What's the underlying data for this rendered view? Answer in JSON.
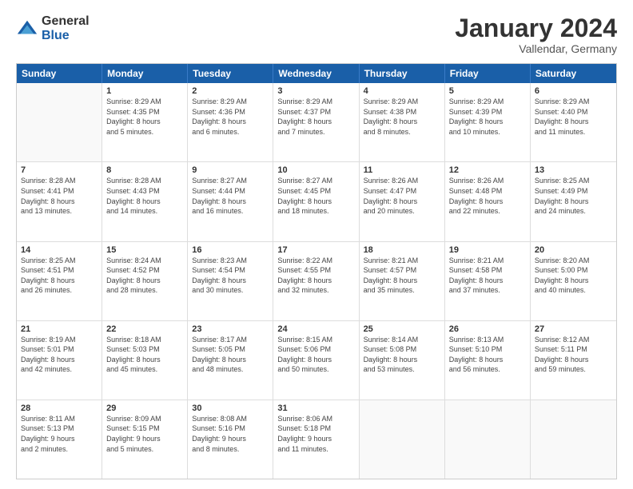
{
  "header": {
    "logo_general": "General",
    "logo_blue": "Blue",
    "month_title": "January 2024",
    "location": "Vallendar, Germany"
  },
  "days_of_week": [
    "Sunday",
    "Monday",
    "Tuesday",
    "Wednesday",
    "Thursday",
    "Friday",
    "Saturday"
  ],
  "weeks": [
    [
      {
        "day": "",
        "info": ""
      },
      {
        "day": "1",
        "info": "Sunrise: 8:29 AM\nSunset: 4:35 PM\nDaylight: 8 hours\nand 5 minutes."
      },
      {
        "day": "2",
        "info": "Sunrise: 8:29 AM\nSunset: 4:36 PM\nDaylight: 8 hours\nand 6 minutes."
      },
      {
        "day": "3",
        "info": "Sunrise: 8:29 AM\nSunset: 4:37 PM\nDaylight: 8 hours\nand 7 minutes."
      },
      {
        "day": "4",
        "info": "Sunrise: 8:29 AM\nSunset: 4:38 PM\nDaylight: 8 hours\nand 8 minutes."
      },
      {
        "day": "5",
        "info": "Sunrise: 8:29 AM\nSunset: 4:39 PM\nDaylight: 8 hours\nand 10 minutes."
      },
      {
        "day": "6",
        "info": "Sunrise: 8:29 AM\nSunset: 4:40 PM\nDaylight: 8 hours\nand 11 minutes."
      }
    ],
    [
      {
        "day": "7",
        "info": "Sunrise: 8:28 AM\nSunset: 4:41 PM\nDaylight: 8 hours\nand 13 minutes."
      },
      {
        "day": "8",
        "info": "Sunrise: 8:28 AM\nSunset: 4:43 PM\nDaylight: 8 hours\nand 14 minutes."
      },
      {
        "day": "9",
        "info": "Sunrise: 8:27 AM\nSunset: 4:44 PM\nDaylight: 8 hours\nand 16 minutes."
      },
      {
        "day": "10",
        "info": "Sunrise: 8:27 AM\nSunset: 4:45 PM\nDaylight: 8 hours\nand 18 minutes."
      },
      {
        "day": "11",
        "info": "Sunrise: 8:26 AM\nSunset: 4:47 PM\nDaylight: 8 hours\nand 20 minutes."
      },
      {
        "day": "12",
        "info": "Sunrise: 8:26 AM\nSunset: 4:48 PM\nDaylight: 8 hours\nand 22 minutes."
      },
      {
        "day": "13",
        "info": "Sunrise: 8:25 AM\nSunset: 4:49 PM\nDaylight: 8 hours\nand 24 minutes."
      }
    ],
    [
      {
        "day": "14",
        "info": "Sunrise: 8:25 AM\nSunset: 4:51 PM\nDaylight: 8 hours\nand 26 minutes."
      },
      {
        "day": "15",
        "info": "Sunrise: 8:24 AM\nSunset: 4:52 PM\nDaylight: 8 hours\nand 28 minutes."
      },
      {
        "day": "16",
        "info": "Sunrise: 8:23 AM\nSunset: 4:54 PM\nDaylight: 8 hours\nand 30 minutes."
      },
      {
        "day": "17",
        "info": "Sunrise: 8:22 AM\nSunset: 4:55 PM\nDaylight: 8 hours\nand 32 minutes."
      },
      {
        "day": "18",
        "info": "Sunrise: 8:21 AM\nSunset: 4:57 PM\nDaylight: 8 hours\nand 35 minutes."
      },
      {
        "day": "19",
        "info": "Sunrise: 8:21 AM\nSunset: 4:58 PM\nDaylight: 8 hours\nand 37 minutes."
      },
      {
        "day": "20",
        "info": "Sunrise: 8:20 AM\nSunset: 5:00 PM\nDaylight: 8 hours\nand 40 minutes."
      }
    ],
    [
      {
        "day": "21",
        "info": "Sunrise: 8:19 AM\nSunset: 5:01 PM\nDaylight: 8 hours\nand 42 minutes."
      },
      {
        "day": "22",
        "info": "Sunrise: 8:18 AM\nSunset: 5:03 PM\nDaylight: 8 hours\nand 45 minutes."
      },
      {
        "day": "23",
        "info": "Sunrise: 8:17 AM\nSunset: 5:05 PM\nDaylight: 8 hours\nand 48 minutes."
      },
      {
        "day": "24",
        "info": "Sunrise: 8:15 AM\nSunset: 5:06 PM\nDaylight: 8 hours\nand 50 minutes."
      },
      {
        "day": "25",
        "info": "Sunrise: 8:14 AM\nSunset: 5:08 PM\nDaylight: 8 hours\nand 53 minutes."
      },
      {
        "day": "26",
        "info": "Sunrise: 8:13 AM\nSunset: 5:10 PM\nDaylight: 8 hours\nand 56 minutes."
      },
      {
        "day": "27",
        "info": "Sunrise: 8:12 AM\nSunset: 5:11 PM\nDaylight: 8 hours\nand 59 minutes."
      }
    ],
    [
      {
        "day": "28",
        "info": "Sunrise: 8:11 AM\nSunset: 5:13 PM\nDaylight: 9 hours\nand 2 minutes."
      },
      {
        "day": "29",
        "info": "Sunrise: 8:09 AM\nSunset: 5:15 PM\nDaylight: 9 hours\nand 5 minutes."
      },
      {
        "day": "30",
        "info": "Sunrise: 8:08 AM\nSunset: 5:16 PM\nDaylight: 9 hours\nand 8 minutes."
      },
      {
        "day": "31",
        "info": "Sunrise: 8:06 AM\nSunset: 5:18 PM\nDaylight: 9 hours\nand 11 minutes."
      },
      {
        "day": "",
        "info": ""
      },
      {
        "day": "",
        "info": ""
      },
      {
        "day": "",
        "info": ""
      }
    ]
  ]
}
